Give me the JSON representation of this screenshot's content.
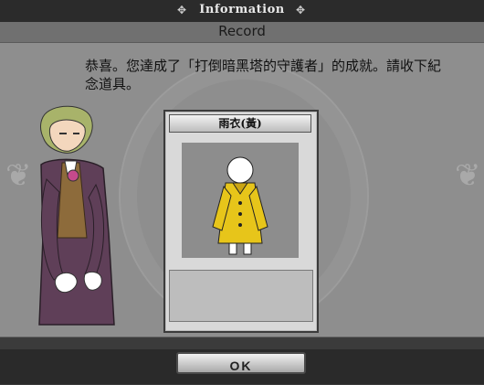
{
  "window": {
    "title": "Information",
    "subtitle": "Record"
  },
  "message": {
    "text": "恭喜。您達成了「打倒暗黑塔的守護者」的成就。請收下紀念道具。"
  },
  "card": {
    "title": "雨衣(黃)"
  },
  "buttons": {
    "ok_label": "OK"
  },
  "icons": {
    "title_left": "ornament-icon",
    "title_right": "ornament-icon",
    "side_left": "fleur-icon",
    "side_right": "fleur-icon"
  },
  "colors": {
    "raincoat": "#e7c51a",
    "character_coat": "#5f3f58",
    "character_hair": "#a8b36a"
  }
}
